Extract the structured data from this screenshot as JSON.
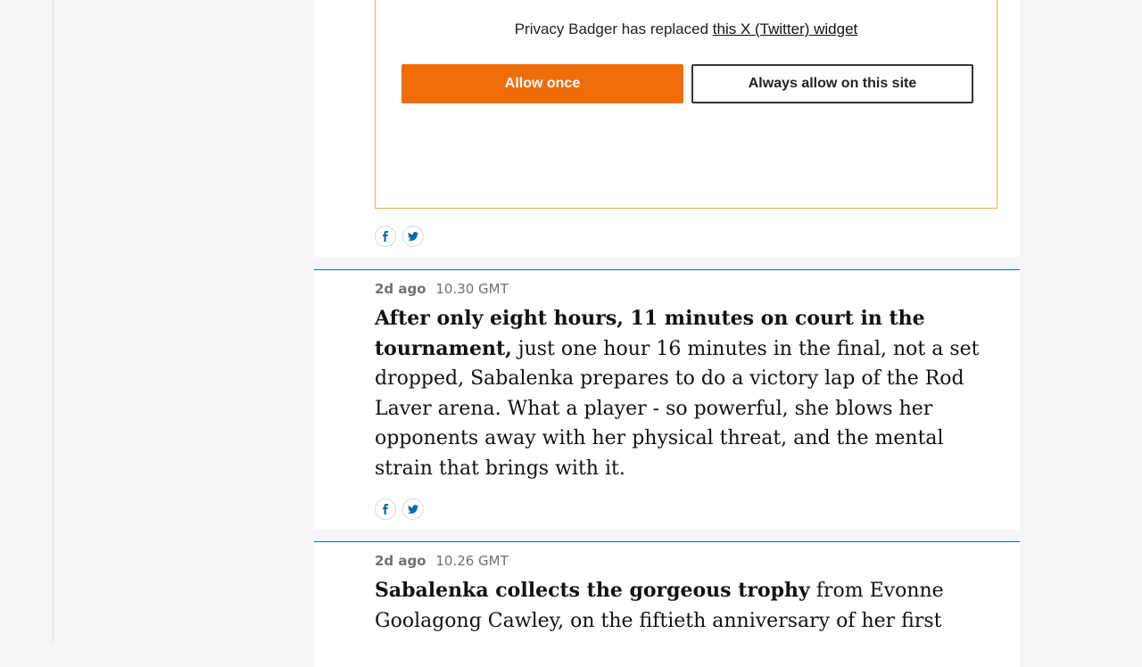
{
  "privacy_badger": {
    "message_prefix": "Privacy Badger has replaced",
    "widget_link": "this X (Twitter) widget",
    "allow_once_label": "Allow once",
    "always_allow_label": "Always allow on this site",
    "accent_color": "#ef6c0b",
    "border_color": "#e8a86a"
  },
  "share_icons": [
    "facebook-icon",
    "twitter-icon"
  ],
  "posts": [
    {
      "ago": "2d ago",
      "time": "10.30 GMT",
      "bold": "After only eight hours, 11 minutes on court in the tournament,",
      "body": " just one hour 16 minutes in the final, not a set dropped, Sabalenka prepares to do a victory lap of the Rod Laver arena. What a player - so powerful, she blows her opponents away with her physical threat, and the mental strain that brings with it."
    },
    {
      "ago": "2d ago",
      "time": "10.26 GMT",
      "bold": "Sabalenka collects the gorgeous trophy",
      "body": " from Evonne Goolagong Cawley, on the fiftieth anniversary of her first"
    }
  ],
  "colors": {
    "divider": "#1b6a8c",
    "share_icon": "#0b6aa0"
  }
}
